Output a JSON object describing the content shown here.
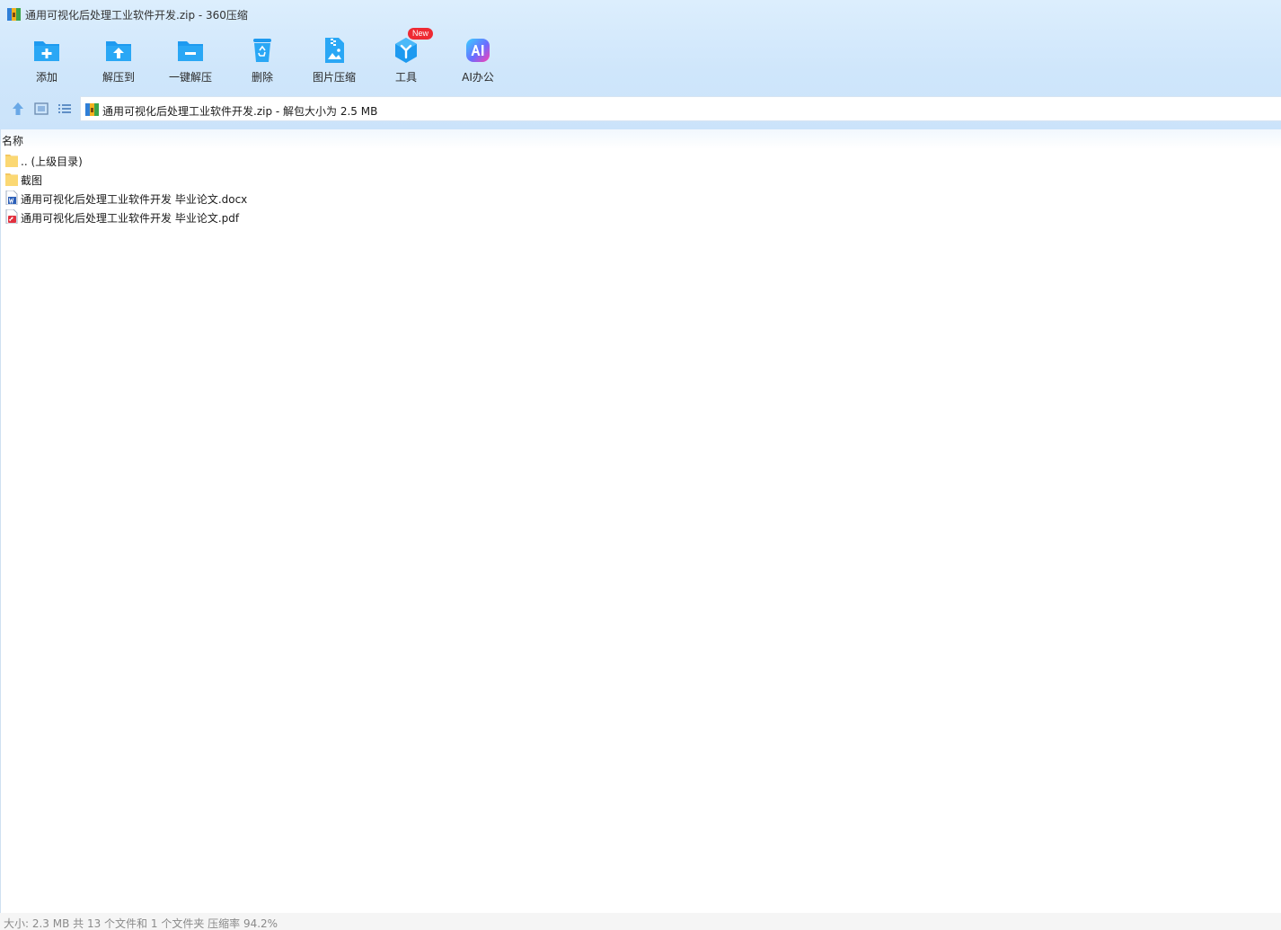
{
  "window": {
    "title": "通用可视化后处理工业软件开发.zip - 360压缩",
    "title_icon": "zip-archive-icon"
  },
  "toolbar": {
    "items": [
      {
        "label": "添加",
        "icon": "add-folder-icon"
      },
      {
        "label": "解压到",
        "icon": "extract-to-icon"
      },
      {
        "label": "一键解压",
        "icon": "one-click-extract-icon"
      },
      {
        "label": "删除",
        "icon": "recycle-bin-icon"
      },
      {
        "label": "图片压缩",
        "icon": "image-compress-icon"
      },
      {
        "label": "工具",
        "icon": "tools-cube-icon",
        "badge": "New"
      },
      {
        "label": "AI办公",
        "icon": "ai-office-icon"
      }
    ]
  },
  "nav": {
    "address_text": "通用可视化后处理工业软件开发.zip - 解包大小为 2.5 MB",
    "buttons": [
      "up-arrow-icon",
      "thumbnail-view-icon",
      "list-view-icon"
    ]
  },
  "filelist": {
    "column_header": "名称",
    "rows": [
      {
        "name": ".. (上级目录)",
        "icon": "folder-icon"
      },
      {
        "name": "截图",
        "icon": "folder-icon"
      },
      {
        "name": "通用可视化后处理工业软件开发 毕业论文.docx",
        "icon": "word-doc-icon"
      },
      {
        "name": "通用可视化后处理工业软件开发 毕业论文.pdf",
        "icon": "pdf-icon"
      }
    ]
  },
  "status": {
    "text": "大小: 2.3 MB 共 13 个文件和 1 个文件夹 压缩率 94.2%"
  },
  "colors": {
    "accent_blue": "#1e9af0",
    "badge_red": "#ee2a33",
    "chrome_bg": "#d4e9fc"
  }
}
